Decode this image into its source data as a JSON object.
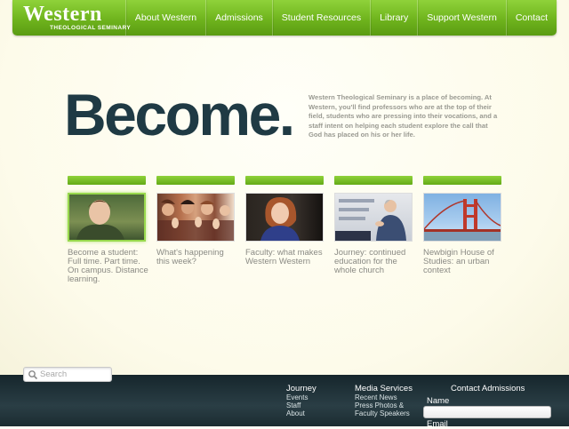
{
  "header": {
    "logo_main": "Western",
    "logo_sub": "THEOLOGICAL SEMINARY",
    "nav": [
      {
        "label": "About Western"
      },
      {
        "label": "Admissions"
      },
      {
        "label": "Student Resources"
      },
      {
        "label": "Library"
      },
      {
        "label": "Support Western"
      },
      {
        "label": "Contact"
      }
    ]
  },
  "hero": {
    "title": "Become.",
    "text": "Western Theological Seminary is a place of becoming. At Western, you'll find professors who are at the top of their field, students who are pressing into their vocations, and a staff intent on helping each student explore the call that God has placed on his or her life."
  },
  "tiles": [
    {
      "caption": "Become a student: Full time. Part time. On campus. Distance learning.",
      "image": "student-photo"
    },
    {
      "caption": "What's happening this week?",
      "image": "applause-photo"
    },
    {
      "caption": "Faculty: what makes Western Western",
      "image": "faculty-photo"
    },
    {
      "caption": "Journey: continued education for the whole church",
      "image": "lecture-photo"
    },
    {
      "caption": "Newbigin House of Studies: an urban context",
      "image": "golden-gate-photo"
    }
  ],
  "footer": {
    "search_placeholder": "Search",
    "journey": {
      "title": "Journey",
      "links": [
        "Events",
        "Staff",
        "About"
      ]
    },
    "media": {
      "title": "Media Services",
      "links": [
        "Recent News",
        "Press Photos &",
        "Faculty Speakers"
      ]
    },
    "contact": {
      "title": "Contact Admissions",
      "name_label": "Name",
      "email_label": "Email"
    }
  },
  "colors": {
    "accent_green": "#6fb41d",
    "title_dark": "#1f3a44",
    "footer_bg": "#1f3238"
  }
}
